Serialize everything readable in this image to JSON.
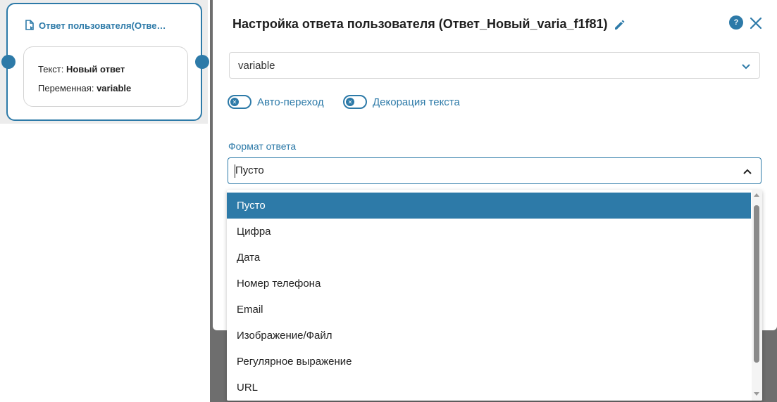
{
  "node": {
    "title": "Ответ пользователя(Отве…",
    "text_label": "Текст:",
    "text_value": "Новый ответ",
    "variable_label": "Переменная:",
    "variable_value": "variable"
  },
  "panel": {
    "title": "Настройка ответа пользователя (Ответ_Новый_varia_f1f81)",
    "help_label": "?",
    "variable_select_value": "variable",
    "toggles": [
      {
        "label": "Авто-переход"
      },
      {
        "label": "Декорация текста"
      }
    ],
    "format_label": "Формат ответа",
    "format_value": "Пусто",
    "format_options": [
      "Пусто",
      "Цифра",
      "Дата",
      "Номер телефона",
      "Email",
      "Изображение/Файл",
      "Регулярное выражение",
      "URL"
    ],
    "selected_option_index": 0
  },
  "colors": {
    "accent": "#2d7aa8",
    "overlay": "#6e6e6e"
  }
}
